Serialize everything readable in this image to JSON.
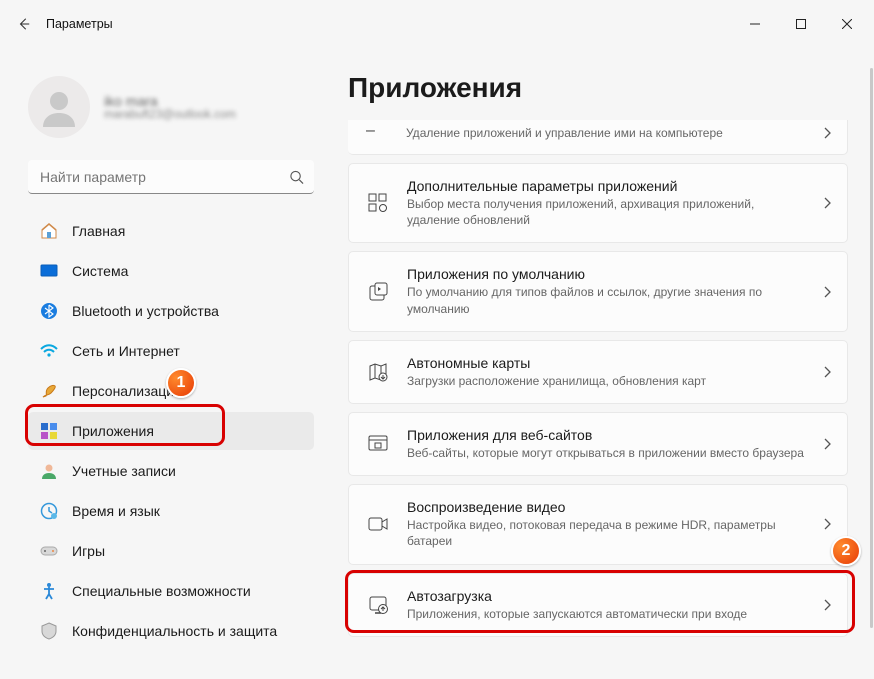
{
  "window": {
    "title": "Параметры",
    "controls": {
      "minimize": "—",
      "maximize": "▢",
      "close": "✕"
    }
  },
  "user": {
    "name": "iko mara",
    "email": "marabuft23@outlook.com"
  },
  "search": {
    "placeholder": "Найти параметр"
  },
  "sidebar": {
    "items": [
      {
        "label": "Главная"
      },
      {
        "label": "Система"
      },
      {
        "label": "Bluetooth и устройства"
      },
      {
        "label": "Сеть и Интернет"
      },
      {
        "label": "Персонализация"
      },
      {
        "label": "Приложения"
      },
      {
        "label": "Учетные записи"
      },
      {
        "label": "Время и язык"
      },
      {
        "label": "Игры"
      },
      {
        "label": "Специальные возможности"
      },
      {
        "label": "Конфиденциальность и защита"
      }
    ]
  },
  "page": {
    "title": "Приложения",
    "partial": {
      "sub": "Удаление приложений и управление ими на компьютере"
    },
    "cards": [
      {
        "title": "Дополнительные параметры приложений",
        "sub": "Выбор места получения приложений, архивация приложений, удаление обновлений"
      },
      {
        "title": "Приложения по умолчанию",
        "sub": "По умолчанию для типов файлов и ссылок, другие значения по умолчанию"
      },
      {
        "title": "Автономные карты",
        "sub": "Загрузки расположение хранилища, обновления карт"
      },
      {
        "title": "Приложения для веб-сайтов",
        "sub": "Веб-сайты, которые могут открываться в приложении вместо браузера"
      },
      {
        "title": "Воспроизведение видео",
        "sub": "Настройка видео, потоковая передача в режиме HDR, параметры батареи"
      },
      {
        "title": "Автозагрузка",
        "sub": "Приложения, которые запускаются автоматически при входе"
      }
    ]
  },
  "annotations": {
    "one": "1",
    "two": "2"
  }
}
